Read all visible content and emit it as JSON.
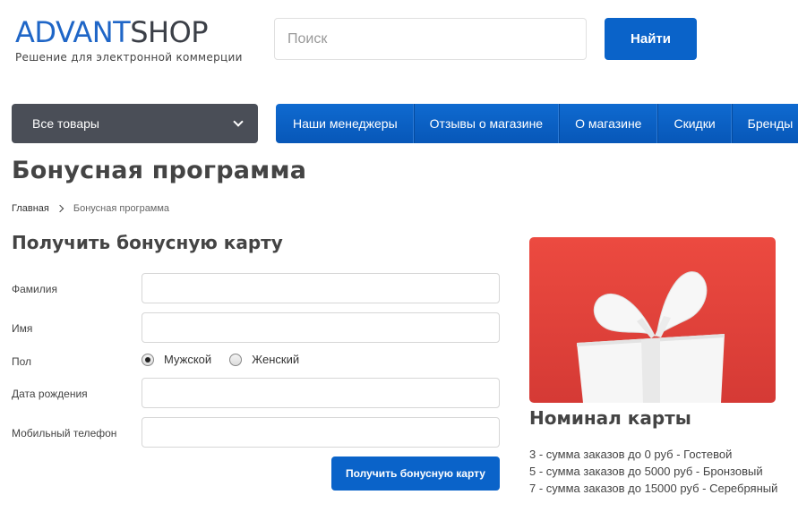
{
  "header": {
    "logo_part1": "ADVANT",
    "logo_part2": "SHOP",
    "logo_tagline": "Решение для электронной коммерции",
    "search_placeholder": "Поиск",
    "search_button": "Найти"
  },
  "nav": {
    "catalog_label": "Все товары",
    "menu": [
      "Наши менеджеры",
      "Отзывы о магазине",
      "О магазине",
      "Скидки",
      "Бренды"
    ]
  },
  "page": {
    "title": "Бонусная программа",
    "breadcrumb": {
      "home": "Главная",
      "current": "Бонусная программа"
    }
  },
  "form": {
    "title": "Получить бонусную карту",
    "labels": {
      "last_name": "Фамилия",
      "first_name": "Имя",
      "gender": "Пол",
      "birth_date": "Дата рождения",
      "mobile_phone": "Мобильный телефон"
    },
    "values": {
      "last_name": "",
      "first_name": "",
      "birth_date": "",
      "mobile_phone": ""
    },
    "gender_options": [
      "Мужской",
      "Женский"
    ],
    "gender_selected": "Мужской",
    "submit": "Получить бонусную карту"
  },
  "card_info": {
    "image_icon": "gift-icon",
    "image_color": "#e0433b",
    "title": "Номинал карты",
    "tiers": [
      "3 - сумма заказов до 0 руб - Гостевой",
      "5 - сумма заказов до 5000 руб - Бронзовый",
      "7 - сумма заказов до 15000 руб - Серебряный"
    ]
  },
  "colors": {
    "accent": "#0a63c9",
    "catalog_bg": "#4a4e57"
  }
}
